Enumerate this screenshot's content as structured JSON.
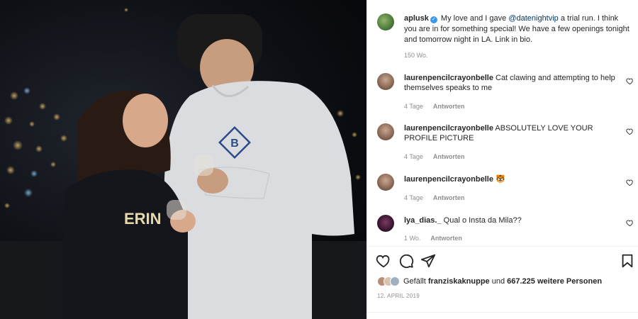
{
  "photo": {
    "hoodie_logo": "B",
    "sweater_text": "ERIN"
  },
  "caption": {
    "username": "aplusk",
    "verified_icon": "✓",
    "text_before": "My love and I gave ",
    "mention": "@datenightvip",
    "text_after": " a trial run. I think you are in for something special! We have a few openings tonight and tomorrow night in LA. Link in bio.",
    "time": "150 Wo."
  },
  "comments": [
    {
      "username": "laurenpencilcrayonbelle",
      "text": "Cat clawing and attempting to help themselves speaks to me",
      "time": "4 Tage",
      "reply": "Antworten"
    },
    {
      "username": "laurenpencilcrayonbelle",
      "text": "ABSOLUTELY LOVE YOUR PROFILE PICTURE",
      "time": "4 Tage",
      "reply": "Antworten"
    },
    {
      "username": "laurenpencilcrayonbelle",
      "text": "🐯",
      "time": "4 Tage",
      "reply": "Antworten"
    },
    {
      "username": "lya_dias._",
      "text": "Qual o Insta da Mila??",
      "time": "1 Wo.",
      "reply": "Antworten"
    }
  ],
  "likes": {
    "prefix": "Gefällt ",
    "user": "franziskaknuppe",
    "middle": " und ",
    "count": "667.225 weitere Personen"
  },
  "date": "12. APRIL 2019",
  "icons": {
    "like": "heart-icon",
    "comment": "comment-icon",
    "share": "paper-plane-icon",
    "save": "bookmark-icon"
  },
  "colors": {
    "mention": "#00376b",
    "verified": "#3897f0",
    "meta": "#8e8e8e"
  }
}
